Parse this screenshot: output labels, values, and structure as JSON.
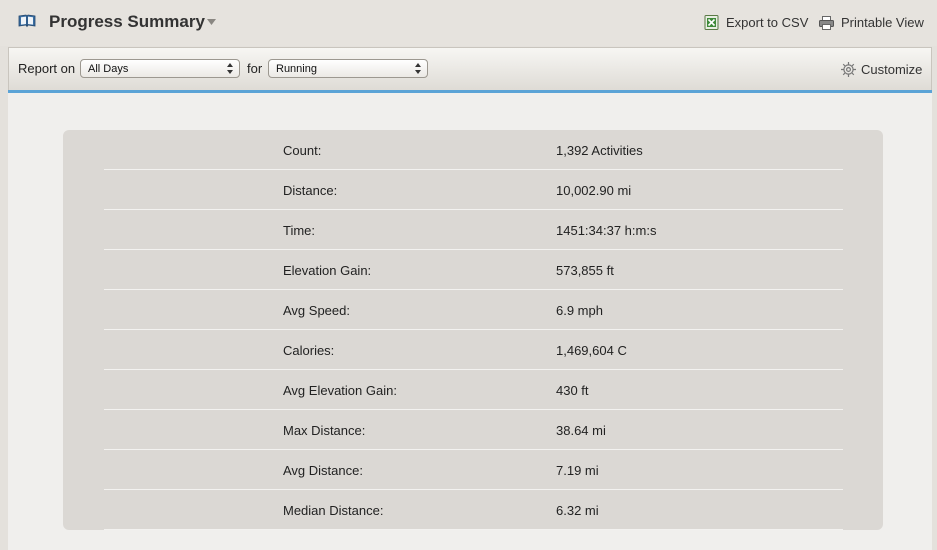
{
  "header": {
    "title": "Progress Summary",
    "icons": {
      "book": "book-icon",
      "caret": "chevron-down-icon"
    },
    "export_label": "Export to CSV",
    "export_icon": "spreadsheet-icon",
    "printable_label": "Printable View",
    "printable_icon": "printer-icon"
  },
  "toolbar": {
    "report_on_label": "Report on",
    "for_label": "for",
    "period_select": {
      "value": "All Days"
    },
    "activity_select": {
      "value": "Running"
    },
    "customize_label": "Customize",
    "customize_icon": "gear-icon",
    "accent_color": "#5ba3d6"
  },
  "summary": {
    "rows": [
      {
        "label": "Count:",
        "value": "1,392 Activities"
      },
      {
        "label": "Distance:",
        "value": "10,002.90 mi"
      },
      {
        "label": "Time:",
        "value": "1451:34:37 h:m:s"
      },
      {
        "label": "Elevation Gain:",
        "value": "573,855 ft"
      },
      {
        "label": "Avg Speed:",
        "value": "6.9 mph"
      },
      {
        "label": "Calories:",
        "value": "1,469,604 C"
      },
      {
        "label": "Avg Elevation Gain:",
        "value": "430 ft"
      },
      {
        "label": "Max Distance:",
        "value": "38.64 mi"
      },
      {
        "label": "Avg Distance:",
        "value": "7.19 mi"
      },
      {
        "label": "Median Distance:",
        "value": "6.32 mi"
      }
    ]
  }
}
